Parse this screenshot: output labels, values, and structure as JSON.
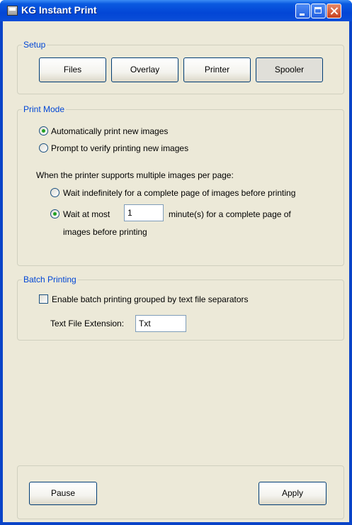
{
  "window": {
    "title": "KG Instant Print"
  },
  "setup": {
    "title": "Setup",
    "buttons": [
      "Files",
      "Overlay",
      "Printer",
      "Spooler"
    ]
  },
  "print_mode": {
    "title": "Print Mode",
    "auto_label": "Automatically print new images",
    "prompt_label": "Prompt to verify printing new images",
    "multi_label": "When the printer supports multiple images per page:",
    "wait_indef_label": "Wait indefinitely for a complete page of images before printing",
    "wait_atmost_label": "Wait at most",
    "wait_minutes_value": "1",
    "minutes_suffix": "minute(s) for a complete page of",
    "minutes_suffix2": "images before printing",
    "selected_mode": "auto",
    "selected_wait": "atmost"
  },
  "batch": {
    "title": "Batch Printing",
    "enable_label": "Enable batch printing grouped by text file separators",
    "enabled": false,
    "ext_label": "Text File Extension:",
    "ext_value": "Txt"
  },
  "bottom": {
    "pause_label": "Pause",
    "apply_label": "Apply"
  }
}
